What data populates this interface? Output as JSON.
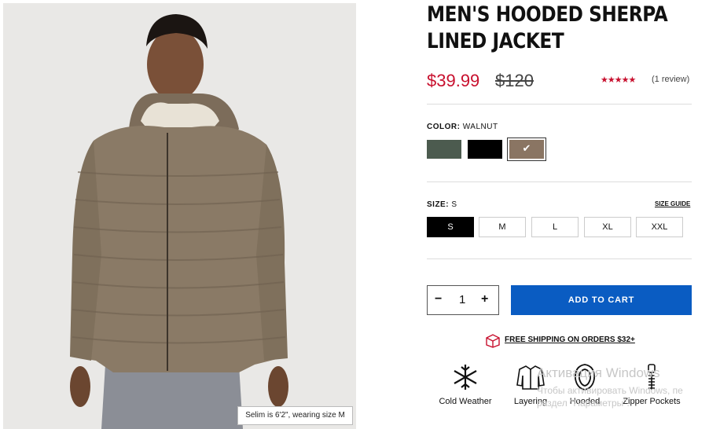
{
  "product": {
    "title_line1": "MEN'S HOODED SHERPA",
    "title_line2": "LINED JACKET",
    "price": "$39.99",
    "original_price": "$120",
    "rating_stars": "★★★★★",
    "rating": 5,
    "review_count": "(1 review)",
    "image_caption": "Selim is 6'2\", wearing size M"
  },
  "color": {
    "label": "COLOR:",
    "selected": "WALNUT",
    "swatches": [
      {
        "name": "olive",
        "hex": "#4c5b4f"
      },
      {
        "name": "black",
        "hex": "#000000"
      },
      {
        "name": "walnut",
        "hex": "#8a7563",
        "selected": true
      }
    ],
    "check": "✔"
  },
  "size": {
    "label": "SIZE:",
    "selected": "S",
    "guide_label": "SIZE GUIDE",
    "options": [
      "S",
      "M",
      "L",
      "XL",
      "XXL"
    ]
  },
  "quantity": {
    "minus": "−",
    "value": "1",
    "plus": "+"
  },
  "actions": {
    "add_to_cart": "ADD TO CART",
    "accent": "#0a5cc2"
  },
  "shipping": {
    "text": "FREE SHIPPING ON ORDERS $32+",
    "icon": "box-icon"
  },
  "features": [
    {
      "label": "Cold Weather",
      "icon": "snowflake-icon"
    },
    {
      "label": "Layering",
      "icon": "jacket-layers-icon"
    },
    {
      "label": "Hooded",
      "icon": "hood-icon"
    },
    {
      "label": "Zipper Pockets",
      "icon": "zipper-icon"
    }
  ],
  "watermark": {
    "line1": "Активация Windows",
    "line2": "Чтобы активировать Windows, пе",
    "line3": "раздел \"Параметры\"."
  },
  "colors": {
    "sale": "#c8102e",
    "jacket": "#8a7a66"
  }
}
